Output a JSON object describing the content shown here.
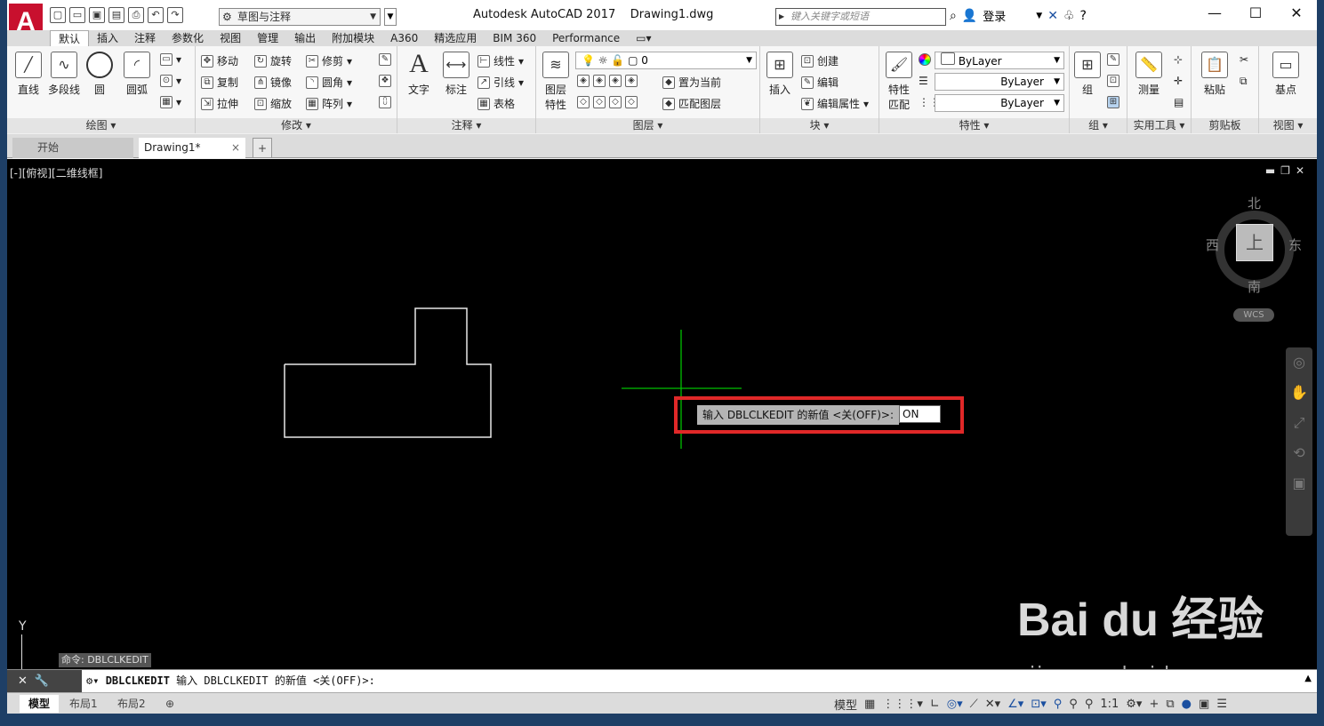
{
  "app": {
    "logo_letter": "A",
    "title": "Autodesk AutoCAD 2017",
    "document": "Drawing1.dwg"
  },
  "workspace": {
    "value": "草图与注释"
  },
  "search": {
    "placeholder": "键入关键字或短语"
  },
  "account": {
    "login": "登录"
  },
  "ribbon_tabs": [
    "默认",
    "插入",
    "注释",
    "参数化",
    "视图",
    "管理",
    "输出",
    "附加模块",
    "A360",
    "精选应用",
    "BIM 360",
    "Performance"
  ],
  "panels": {
    "draw": {
      "title": "绘图 ▾",
      "line": "直线",
      "polyline": "多段线",
      "circle": "圆",
      "arc": "圆弧"
    },
    "modify": {
      "title": "修改 ▾",
      "move": "移动",
      "rotate": "旋转",
      "trim": "修剪",
      "copy": "复制",
      "mirror": "镜像",
      "fillet": "圆角",
      "stretch": "拉伸",
      "scale": "缩放",
      "array": "阵列"
    },
    "annotation": {
      "title": "注释 ▾",
      "text": "文字",
      "dim": "标注",
      "linear": "线性",
      "leader": "引线",
      "table": "表格"
    },
    "layers": {
      "title": "图层 ▾",
      "props_l1": "图层",
      "props_l2": "特性",
      "current_layer": "0",
      "set_current": "置为当前",
      "match_layer": "匹配图层"
    },
    "block": {
      "title": "块 ▾",
      "insert": "插入",
      "create": "创建",
      "edit": "编辑",
      "edit_attr": "编辑属性"
    },
    "properties": {
      "title": "特性 ▾",
      "match_l1": "特性",
      "match_l2": "匹配",
      "color": "ByLayer",
      "linetype": "ByLayer",
      "lineweight": "ByLayer"
    },
    "groups": {
      "title": "组 ▾",
      "group": "组"
    },
    "utilities": {
      "title": "实用工具 ▾",
      "measure": "测量"
    },
    "clipboard": {
      "title": "剪贴板",
      "paste": "粘贴"
    },
    "view": {
      "title": "视图 ▾",
      "base": "基点"
    }
  },
  "doc_tabs": {
    "start": "开始",
    "current": "Drawing1*",
    "close": "×",
    "add": "+"
  },
  "viewport": {
    "label": "[-][俯视][二维线框]"
  },
  "viewcube": {
    "north": "北",
    "south": "南",
    "east": "东",
    "west": "西",
    "top": "上",
    "wcs": "WCS"
  },
  "ucs": {
    "y": "Y"
  },
  "dynamic_prompt": {
    "text": "输入 DBLCLKEDIT 的新值 <关(OFF)>:",
    "value": "ON"
  },
  "command_history": "命令: DBLCLKEDIT",
  "command_line": {
    "cmd": "DBLCLKEDIT",
    "text": " 输入 DBLCLKEDIT 的新值 <关(OFF)>:"
  },
  "layout_tabs": [
    "模型",
    "布局1",
    "布局2"
  ],
  "status": {
    "model": "模型",
    "scale": "1:1"
  },
  "watermark": {
    "brand": "Bai du 经验",
    "url": "jingyan.baidu.com"
  },
  "colors": {
    "accent": "#c8102e",
    "highlight_box": "#e02828",
    "crosshair": "#00c000"
  }
}
